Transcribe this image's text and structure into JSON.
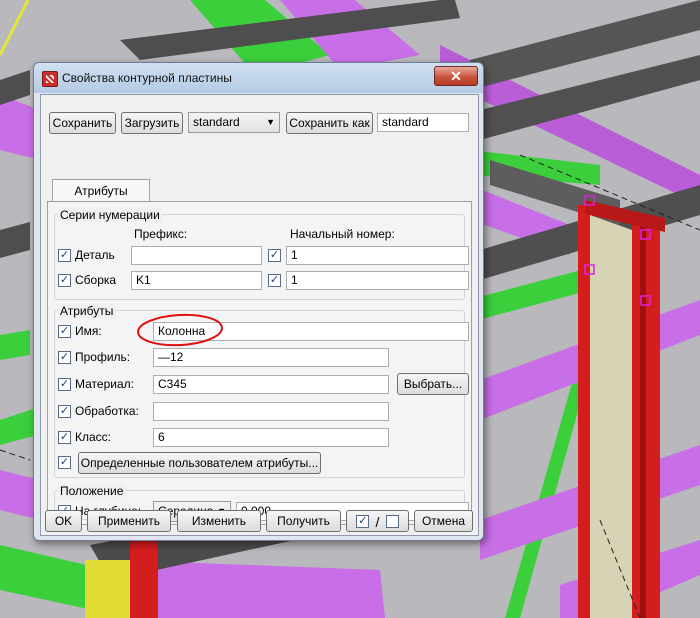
{
  "dialog": {
    "title": "Свойства контурной пластины",
    "close_glyph": "✕"
  },
  "toolbar": {
    "save_label": "Сохранить",
    "load_label": "Загрузить",
    "preset_value": "standard",
    "save_as_label": "Сохранить как",
    "save_as_name": "standard"
  },
  "tabs": {
    "attributes": "Атрибуты"
  },
  "numbering": {
    "group_title": "Серии нумерации",
    "prefix_header": "Префикс:",
    "start_header": "Начальный номер:",
    "part_label": "Деталь",
    "part_prefix": "",
    "part_start": "1",
    "assembly_label": "Сборка",
    "assembly_prefix": "K1",
    "assembly_start": "1"
  },
  "attributes": {
    "group_title": "Атрибуты",
    "name_label": "Имя:",
    "name_value": "Колонна",
    "profile_label": "Профиль:",
    "profile_value": "—12",
    "material_label": "Материал:",
    "material_value": "C345",
    "select_label": "Выбрать...",
    "finish_label": "Обработка:",
    "finish_value": "",
    "class_label": "Класс:",
    "class_value": "6",
    "user_attrs_label": "Определенные пользователем атрибуты..."
  },
  "position": {
    "group_title": "Положение",
    "depth_label": "На глубине:",
    "depth_option": "Середина",
    "depth_offset": "0.000"
  },
  "footer": {
    "ok_label": "OK",
    "apply_label": "Применить",
    "modify_label": "Изменить",
    "get_label": "Получить",
    "toggle_separator": "/",
    "cancel_label": "Отмена"
  },
  "colors": {
    "steel_gray": "#5a5a5a",
    "magenta_beam": "#c86ee6",
    "green_plate": "#37c837",
    "red_column": "#d41e1e",
    "yellow_part": "#e1dc32",
    "annotation_red": "#e01010"
  },
  "check_glyph": "✓"
}
